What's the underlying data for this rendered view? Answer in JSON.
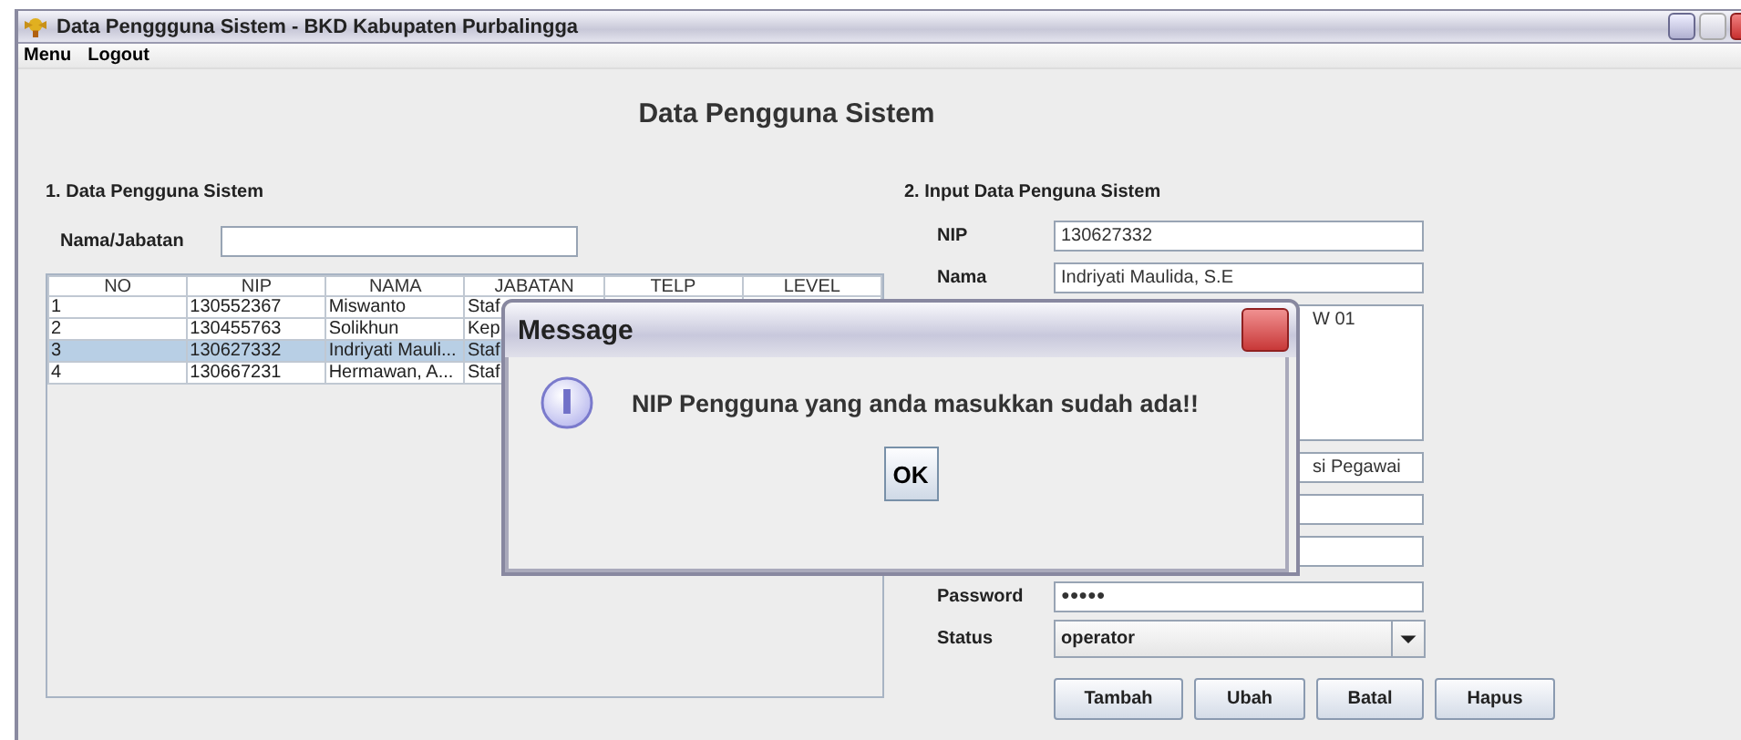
{
  "window": {
    "title": "Data Penggguna Sistem - BKD Kabupaten Purbalingga"
  },
  "menu": [
    "Menu",
    "Logout"
  ],
  "heading": "Data Pengguna Sistem",
  "left_panel": {
    "title": "1. Data Pengguna Sistem",
    "search_label": "Nama/Jabatan",
    "table": {
      "columns": [
        "NO",
        "NIP",
        "NAMA",
        "JABATAN",
        "TELP",
        "LEVEL"
      ],
      "rows": [
        {
          "cells": [
            "1",
            "130552367",
            "Miswanto",
            "Staf"
          ],
          "selected": false
        },
        {
          "cells": [
            "2",
            "130455763",
            "Solikhun",
            "Kep"
          ],
          "selected": false
        },
        {
          "cells": [
            "3",
            "130627332",
            "Indriyati Mauli...",
            "Staf"
          ],
          "selected": true
        },
        {
          "cells": [
            "4",
            "130667231",
            "Hermawan, A...",
            "Staf"
          ],
          "selected": false
        }
      ]
    }
  },
  "right_panel": {
    "title": "2. Input Data Penguna Sistem",
    "fields": [
      {
        "kind": "text",
        "label": "NIP",
        "value": "130627332"
      },
      {
        "kind": "text",
        "label": "Nama",
        "value": "Indriyati Maulida, S.E"
      },
      {
        "kind": "area",
        "value": "W 01"
      },
      {
        "kind": "text",
        "value": "si Pegawai"
      },
      {
        "kind": "text"
      },
      {
        "kind": "text"
      },
      {
        "kind": "password",
        "label": "Password",
        "value": "●●●●●"
      },
      {
        "kind": "combo",
        "label": "Status",
        "value": "operator"
      }
    ],
    "buttons": [
      "Tambah",
      "Ubah",
      "Batal",
      "Hapus"
    ]
  },
  "dialog": {
    "title": "Message",
    "message": "NIP Pengguna yang anda masukkan sudah ada!!",
    "button": "OK"
  }
}
